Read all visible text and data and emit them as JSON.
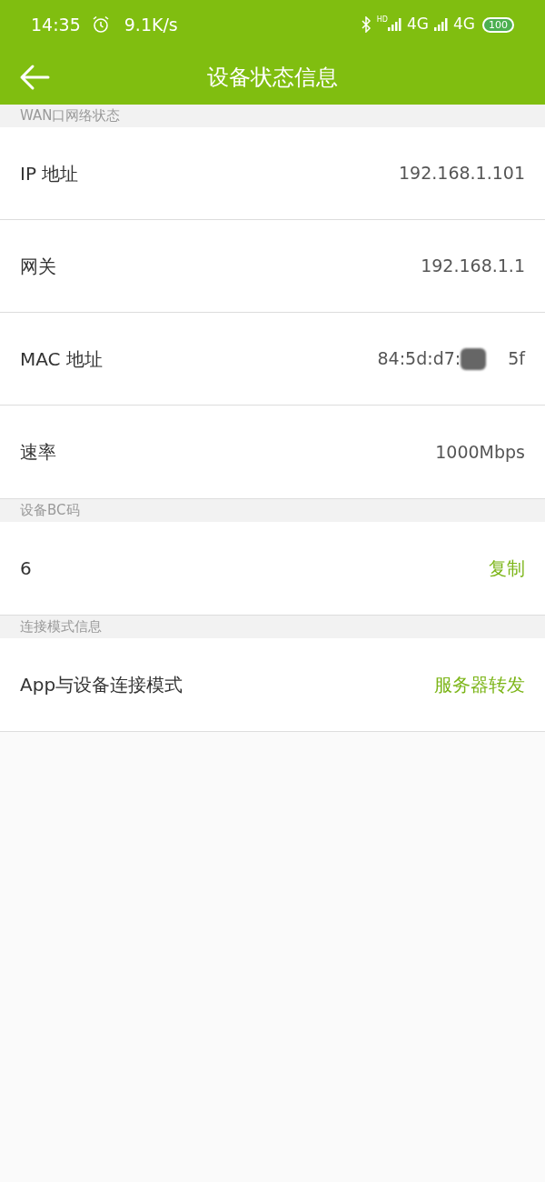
{
  "status_bar": {
    "time": "14:35",
    "speed": "9.1K/s",
    "hd": "HD",
    "network_1": "4G",
    "network_2": "4G",
    "battery": "100"
  },
  "app_bar": {
    "title": "设备状态信息"
  },
  "sections": [
    {
      "header": "WAN口网络状态",
      "rows": [
        {
          "kind": "text",
          "label": "IP 地址",
          "value": "192.168.1.101"
        },
        {
          "kind": "text",
          "label": "网关",
          "value": "192.168.1.1"
        },
        {
          "kind": "masked",
          "label": "MAC 地址",
          "value": "84:5d:d7:",
          "value_end": "5f"
        },
        {
          "kind": "text",
          "label": "速率",
          "value": "1000Mbps"
        }
      ]
    },
    {
      "header": "设备BC码",
      "rows": [
        {
          "kind": "action",
          "label": "6",
          "value": "复制"
        }
      ]
    },
    {
      "header": "连接模式信息",
      "rows": [
        {
          "kind": "accent",
          "label": "App与设备连接模式",
          "value": "服务器转发"
        }
      ]
    }
  ]
}
